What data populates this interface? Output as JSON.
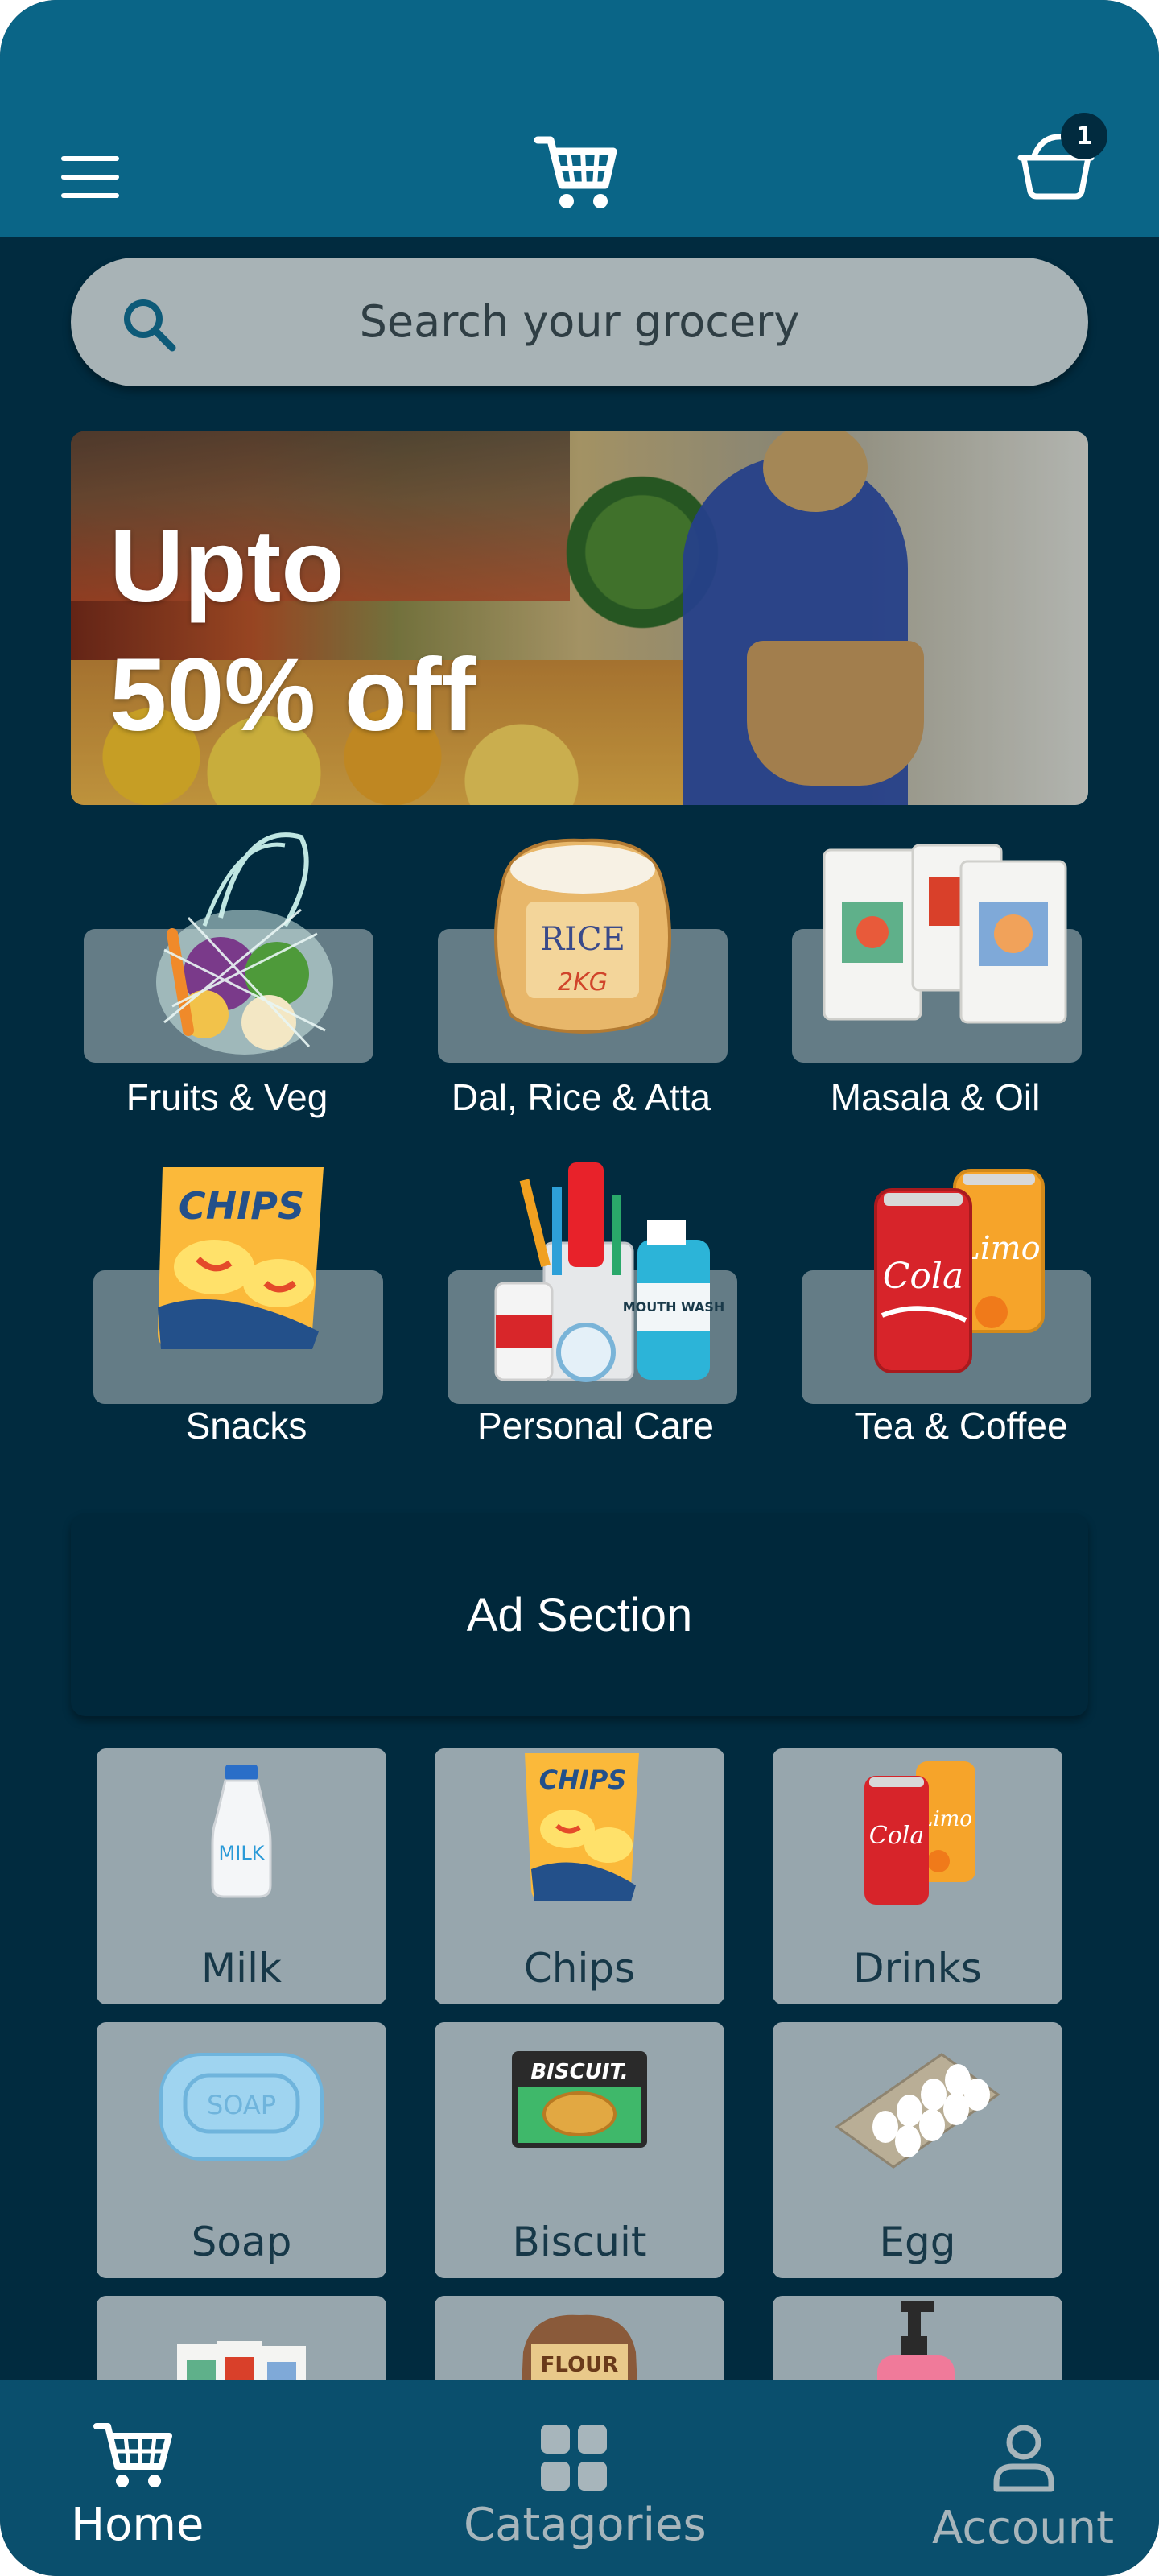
{
  "header": {
    "cart_badge_count": "1"
  },
  "search": {
    "placeholder": "Search your grocery"
  },
  "banner": {
    "line1": "Upto",
    "line2": "50% off"
  },
  "categories": [
    {
      "label": "Fruits & Veg"
    },
    {
      "label": "Dal, Rice & Atta"
    },
    {
      "label": "Masala & Oil"
    },
    {
      "label": "Snacks"
    },
    {
      "label": "Personal Care"
    },
    {
      "label": "Tea & Coffee"
    }
  ],
  "category_art_text": {
    "rice": "RICE",
    "rice_weight": "2KG",
    "chips": "CHIPS",
    "cola": "Cola",
    "limo": "Limo",
    "mouthwash": "MOUTH WASH"
  },
  "ad": {
    "label": "Ad Section"
  },
  "products": [
    {
      "label": "Milk"
    },
    {
      "label": "Chips"
    },
    {
      "label": "Drinks"
    },
    {
      "label": "Soap"
    },
    {
      "label": "Biscuit"
    },
    {
      "label": "Egg"
    }
  ],
  "product_art_text": {
    "milk": "MILK",
    "chips": "CHIPS",
    "cola": "Cola",
    "limo": "Limo",
    "soap": "SOAP",
    "biscuit": "BISCUIT.",
    "flour": "FLOUR"
  },
  "bottom_nav": {
    "home": "Home",
    "categories": "Catagories",
    "account": "Account"
  },
  "colors": {
    "background": "#012b3f",
    "header": "#0a6587",
    "nav_active": "#ffffff",
    "nav_inactive": "#a7b5bb"
  }
}
